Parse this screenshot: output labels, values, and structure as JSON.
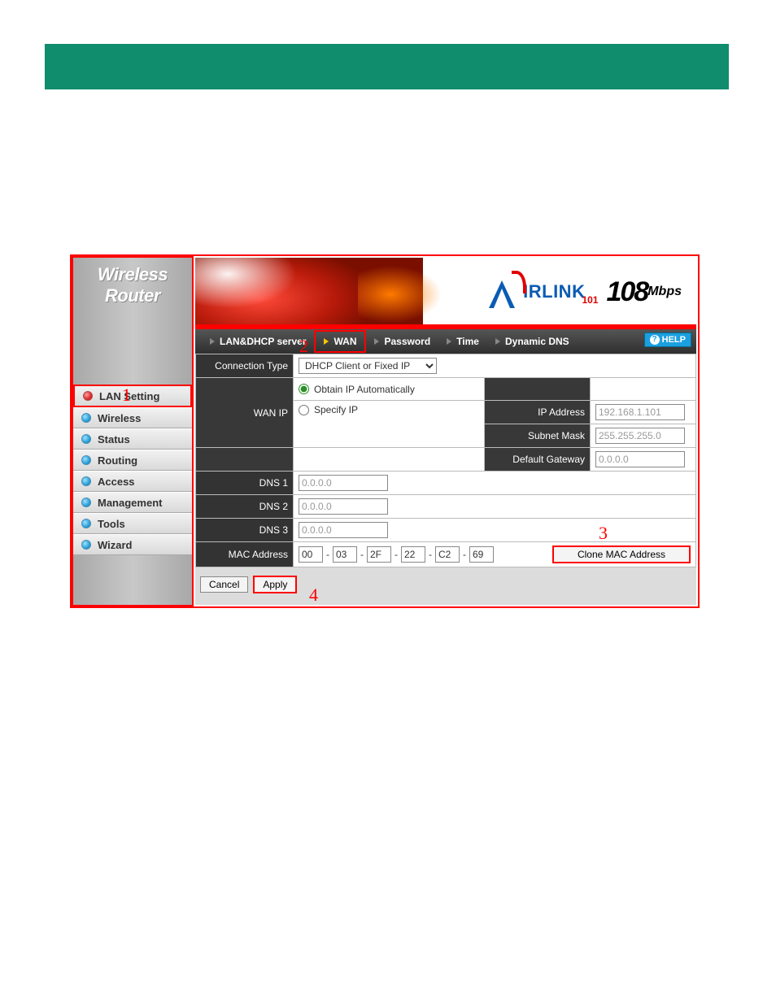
{
  "product": {
    "line1": "Wireless",
    "line2": "Router"
  },
  "brand": {
    "irlink": "IRLINK",
    "sub": "101",
    "speed": "108",
    "unit": "Mbps"
  },
  "sidebar": {
    "items": [
      {
        "label": "LAN Setting",
        "active": true
      },
      {
        "label": "Wireless",
        "active": false
      },
      {
        "label": "Status",
        "active": false
      },
      {
        "label": "Routing",
        "active": false
      },
      {
        "label": "Access",
        "active": false
      },
      {
        "label": "Management",
        "active": false
      },
      {
        "label": "Tools",
        "active": false
      },
      {
        "label": "Wizard",
        "active": false
      }
    ]
  },
  "tabs": {
    "items": [
      {
        "label": "LAN&DHCP server",
        "active": false
      },
      {
        "label": "WAN",
        "active": true
      },
      {
        "label": "Password",
        "active": false
      },
      {
        "label": "Time",
        "active": false
      },
      {
        "label": "Dynamic DNS",
        "active": false
      }
    ],
    "help_label": "HELP"
  },
  "form": {
    "conn_type_label": "Connection Type",
    "conn_type_value": "DHCP Client or Fixed IP",
    "wan_ip_label": "WAN IP",
    "obtain_label": "Obtain IP Automatically",
    "specify_label": "Specify IP",
    "ip_label": "IP Address",
    "ip_value": "192.168.1.101",
    "mask_label": "Subnet Mask",
    "mask_value": "255.255.255.0",
    "gw_label": "Default Gateway",
    "gw_value": "0.0.0.0",
    "dns1_label": "DNS 1",
    "dns1_value": "0.0.0.0",
    "dns2_label": "DNS 2",
    "dns2_value": "0.0.0.0",
    "dns3_label": "DNS 3",
    "dns3_value": "0.0.0.0",
    "mac_label": "MAC Address",
    "mac": [
      "00",
      "03",
      "2F",
      "22",
      "C2",
      "69"
    ],
    "clone_label": "Clone MAC Address",
    "cancel_label": "Cancel",
    "apply_label": "Apply"
  },
  "annotations": {
    "a1": "1",
    "a2": "2",
    "a3": "3",
    "a4": "4"
  }
}
